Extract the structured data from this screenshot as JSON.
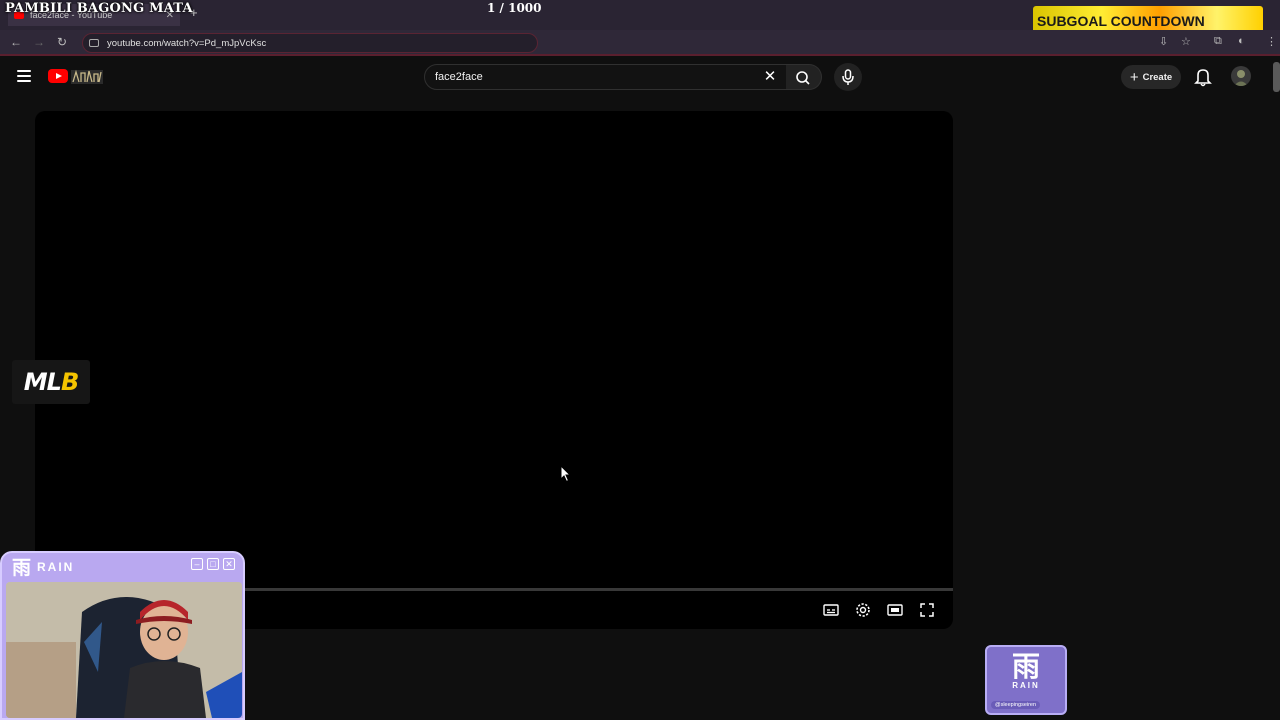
{
  "overlay": {
    "title": "PAMBILI BAGONG MATA",
    "counter": "1   / 1000",
    "banner_text": "SUBGOAL COUNTDOWN"
  },
  "browser": {
    "tab_title": "face2face - YouTube",
    "url": "youtube.com/watch?v=Pd_mJpVcKsc"
  },
  "youtube": {
    "search_value": "face2face",
    "create_label": "Create"
  },
  "stream": {
    "sponsor_logo_text": "ML",
    "sponsor_logo_highlight": "B",
    "webcam_kanji": "雨",
    "webcam_name": "RAIN",
    "badge_kanji": "雨",
    "badge_name": "RAIN",
    "badge_handle": "@sleepingseiren"
  },
  "icons": [
    "hamburger-icon",
    "youtube-logo-icon",
    "search-icon",
    "close-icon",
    "mic-icon",
    "plus-icon",
    "bell-icon",
    "subtitles-icon",
    "settings-icon",
    "theater-icon",
    "fullscreen-icon"
  ],
  "colors": {
    "page_bg": "#0f0f0f",
    "yt_red": "#ff0000",
    "tab_bg": "#2a2433",
    "overlay_purple": "#b9a8f0"
  }
}
